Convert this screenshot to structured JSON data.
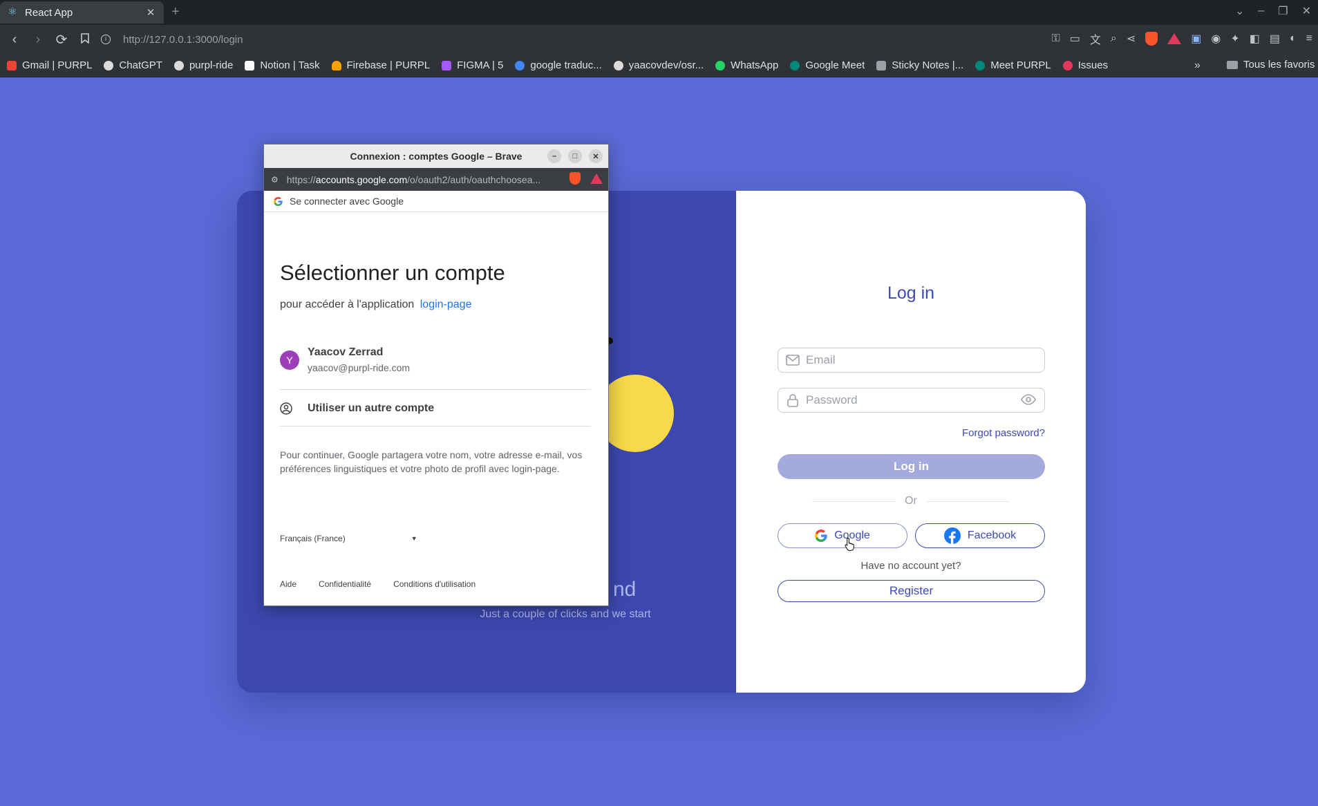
{
  "browser": {
    "tab_title": "React App",
    "tab_close": "✕",
    "new_tab": "+",
    "url": "http://127.0.0.1:3000/login",
    "bookmarks": [
      {
        "label": "Gmail | PURPL",
        "color": "#ea4335"
      },
      {
        "label": "ChatGPT",
        "color": "#dcdcdc"
      },
      {
        "label": "purpl-ride",
        "color": "#dcdcdc"
      },
      {
        "label": "Notion | Task",
        "color": "#ffffff"
      },
      {
        "label": "Firebase | PURPL",
        "color": "#ffa000"
      },
      {
        "label": "FIGMA | 5",
        "color": "#a259ff"
      },
      {
        "label": "google traduc...",
        "color": "#4285f4"
      },
      {
        "label": "yaacovdev/osr...",
        "color": "#dcdcdc"
      },
      {
        "label": "WhatsApp",
        "color": "#25d366"
      },
      {
        "label": "Google Meet",
        "color": "#00897b"
      },
      {
        "label": "Sticky Notes |...",
        "color": "#9aa0a6"
      },
      {
        "label": "Meet PURPL",
        "color": "#00897b"
      },
      {
        "label": "Issues",
        "color": "#e2385b"
      }
    ],
    "more_bookmarks": "»",
    "all_bookmarks": "Tous les favoris"
  },
  "login": {
    "title": "Log in",
    "email_placeholder": "Email",
    "password_placeholder": "Password",
    "forgot": "Forgot password?",
    "login_button": "Log in",
    "or": "Or",
    "google": "Google",
    "facebook": "Facebook",
    "no_account": "Have no account yet?",
    "register": "Register",
    "welcome_fragment": "nd",
    "tagline": "Just a couple of clicks and we start"
  },
  "popup": {
    "window_title": "Connexion : comptes Google – Brave",
    "url_prefix": "https://",
    "url_domain": "accounts.google.com",
    "url_path": "/o/oauth2/auth/oauthchoosea...",
    "header": "Se connecter avec Google",
    "heading": "Sélectionner un compte",
    "subtitle": "pour accéder à l'application",
    "app_name": "login-page",
    "account": {
      "initial": "Y",
      "name": "Yaacov Zerrad",
      "email": "yaacov@purpl-ride.com"
    },
    "other_account": "Utiliser un autre compte",
    "notice": "Pour continuer, Google partagera votre nom, votre adresse e-mail, vos préférences linguistiques et votre photo de profil avec login-page.",
    "language": "Français (France)",
    "footer": [
      "Aide",
      "Confidentialité",
      "Conditions d'utilisation"
    ]
  },
  "colors": {
    "page_bg": "#5a6ad6",
    "panel_bg": "#3c48ae",
    "accent": "#3c4ab2",
    "google_blue": "#1a73e8"
  }
}
